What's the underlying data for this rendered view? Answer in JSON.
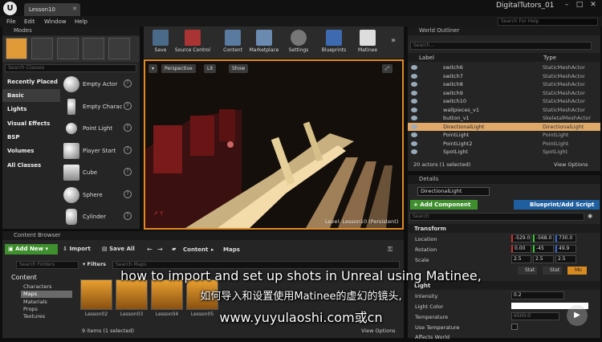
{
  "window": {
    "tab": "Lesson10",
    "project": "DigitalTutors_01"
  },
  "menu": [
    "File",
    "Edit",
    "Window",
    "Help"
  ],
  "help_search": "Search For Help",
  "modes": {
    "title": "Modes",
    "search_placeholder": "Search Classes",
    "categories": [
      "Recently Placed",
      "Basic",
      "Lights",
      "Visual Effects",
      "BSP",
      "Volumes",
      "All Classes"
    ],
    "actors": [
      "Empty Actor",
      "Empty Charac",
      "Point Light",
      "Player Start",
      "Cube",
      "Sphere",
      "Cylinder"
    ]
  },
  "toolbar": [
    "Save",
    "Source Control",
    "Content",
    "Marketplace",
    "Settings",
    "Blueprints",
    "Matinee"
  ],
  "viewport": {
    "perspective": "Perspective",
    "lit": "Lit",
    "show": "Show",
    "level_label": "Level:",
    "level_name": "Lesson10 (Persistent)"
  },
  "outliner": {
    "title": "World Outliner",
    "search_placeholder": "Search...",
    "col_label": "Label",
    "col_type": "Type",
    "rows": [
      {
        "label": "switch6",
        "type": "StaticMeshActor"
      },
      {
        "label": "switch7",
        "type": "StaticMeshActor"
      },
      {
        "label": "switch8",
        "type": "StaticMeshActor"
      },
      {
        "label": "switch9",
        "type": "StaticMeshActor"
      },
      {
        "label": "switch10",
        "type": "StaticMeshActor"
      },
      {
        "label": "wallpieces_v1",
        "type": "StaticMeshActor"
      },
      {
        "label": "button_v1",
        "type": "SkeletalMeshActor"
      },
      {
        "label": "DirectionalLight",
        "type": "DirectionalLight"
      },
      {
        "label": "PointLight",
        "type": "PointLight"
      },
      {
        "label": "PointLight2",
        "type": "PointLight"
      },
      {
        "label": "SpotLight",
        "type": "SpotLight"
      }
    ],
    "footer": "20 actors (1 selected)",
    "view_options": "View Options"
  },
  "details": {
    "title": "Details",
    "name": "DirectionalLight",
    "add_component": "+ Add Component",
    "blueprint": "Blueprint/Add Script",
    "search_placeholder": "Search",
    "transform": "Transform",
    "location_label": "Location",
    "location": [
      "-529.0",
      "-568.0",
      "730.0"
    ],
    "rotation_label": "Rotation",
    "rotation": [
      "0.00",
      "-45",
      "49.9"
    ],
    "scale_label": "Scale",
    "scale": [
      "2.5",
      "2.5",
      "2.5"
    ],
    "mobility": [
      "Stat",
      "Stat",
      "Mo"
    ],
    "light": "Light",
    "intensity_label": "Intensity",
    "intensity": "0.2",
    "light_color": "Light Color",
    "temperature_label": "Temperature",
    "temperature": "6500.0",
    "use_temperature": "Use Temperature",
    "affects_world": "Affects World"
  },
  "content_browser": {
    "title": "Content Browser",
    "add_new": "Add New",
    "import": "Import",
    "save_all": "Save All",
    "path": [
      "Content",
      "Maps"
    ],
    "search_folders": "Search Folders",
    "filters": "Filters",
    "search_maps": "Search Maps",
    "folders": [
      "Content",
      "Characters",
      "Maps",
      "Materials",
      "Props",
      "Textures"
    ],
    "assets": [
      "Lesson02",
      "Lesson03",
      "Lesson04",
      "Lesson05"
    ],
    "items": "9 items (1 selected)",
    "view_options": "View Options"
  },
  "subtitles": {
    "english": "how to import and set up shots in Unreal using Matinee,",
    "chinese": "如何导入和设置使用Matinee的虚幻的镜头,",
    "site": "www.yuyulaoshi.com或cn"
  },
  "colors": {
    "accent": "#e08a20",
    "selected_row": "#e0a96a",
    "add_green": "#3f8f2f",
    "blueprint_blue": "#1f5f9f"
  }
}
